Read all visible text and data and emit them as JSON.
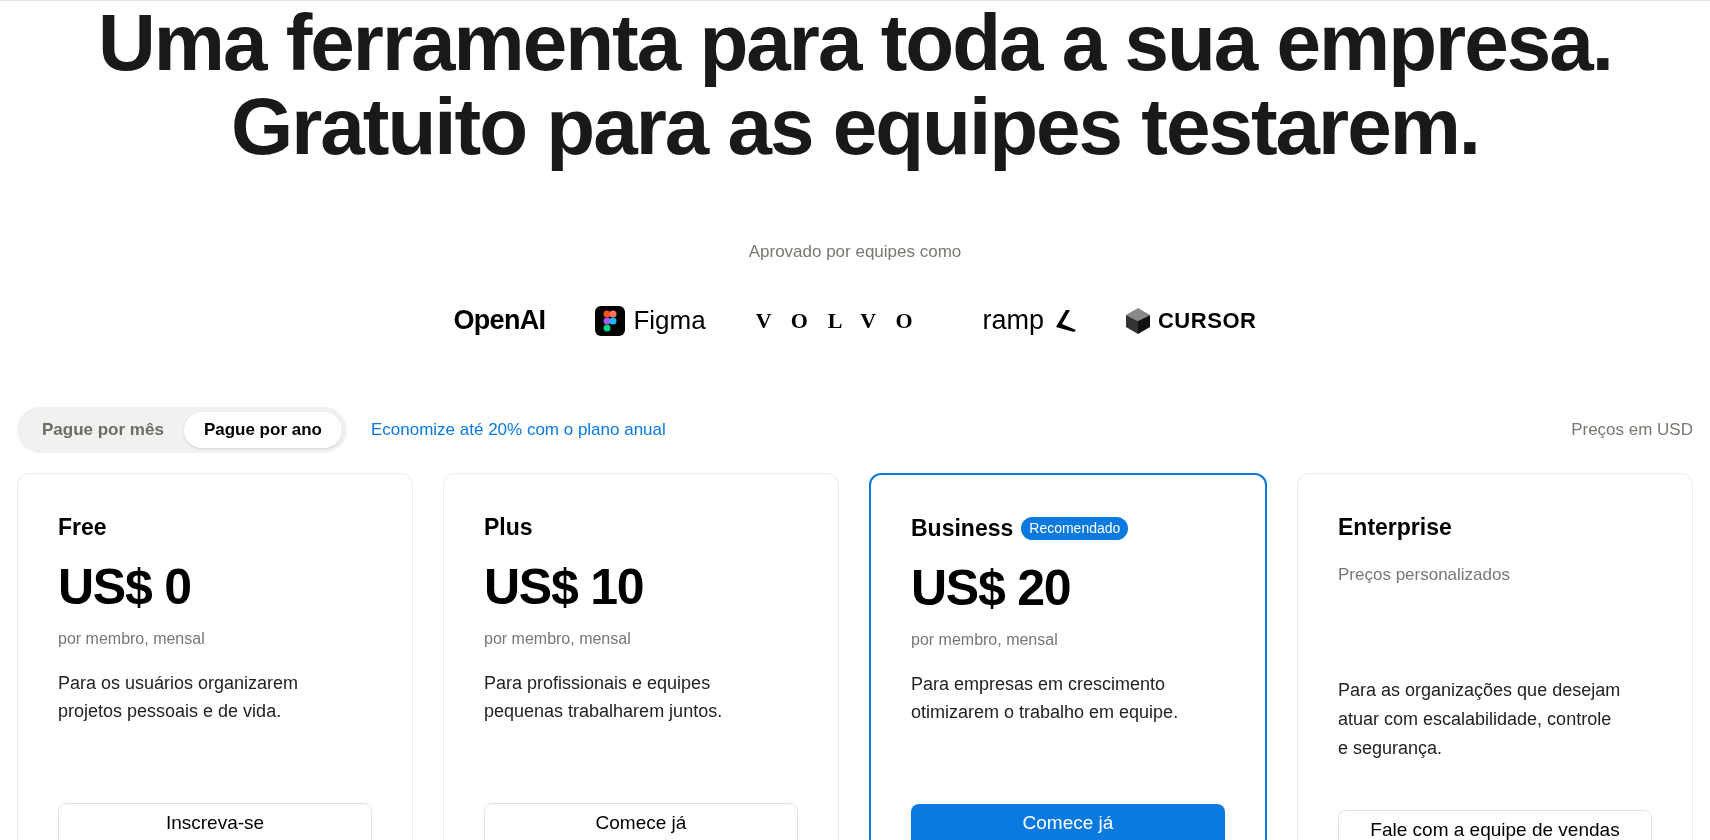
{
  "headline": [
    "Uma ferramenta para toda a sua empresa.",
    "Gratuito para as equipes testarem."
  ],
  "trusted_by": {
    "label": "Aprovado por equipes como",
    "logos": [
      {
        "kind": "openai",
        "text": "OpenAI"
      },
      {
        "kind": "figma",
        "text": "Figma"
      },
      {
        "kind": "volvo",
        "text": "VOLVO"
      },
      {
        "kind": "ramp",
        "text": "ramp"
      },
      {
        "kind": "cursor",
        "text": "CURSOR"
      }
    ]
  },
  "billing_toggle": [
    {
      "label": "Pague por mês",
      "selected": false
    },
    {
      "label": "Pague por ano",
      "selected": true
    }
  ],
  "savings_note": "Economize até 20% com o plano anual",
  "currency_note": "Preços em USD",
  "plans": [
    {
      "name": "Free",
      "price": "US$ 0",
      "price_note": "por membro, mensal",
      "description": "Para os usuários organizarem projetos pessoais e de vida.",
      "button": "Inscreva-se",
      "highlighted": false
    },
    {
      "name": "Plus",
      "price": "US$ 10",
      "price_note": "por membro, mensal",
      "description": "Para profissionais e equipes pequenas trabalharem juntos.",
      "button": "Comece já",
      "highlighted": false
    },
    {
      "name": "Business",
      "badge": "Recomendado",
      "price": "US$ 20",
      "price_note": "por membro, mensal",
      "description": "Para empresas em crescimento otimizarem o trabalho em equipe.",
      "button": "Comece já",
      "highlighted": true
    },
    {
      "name": "Enterprise",
      "subtitle": "Preços personalizados",
      "description": "Para as organizações que desejam atuar com escalabilidade, controle e segurança.",
      "button": "Fale com a equipe de vendas",
      "highlighted": false
    }
  ]
}
